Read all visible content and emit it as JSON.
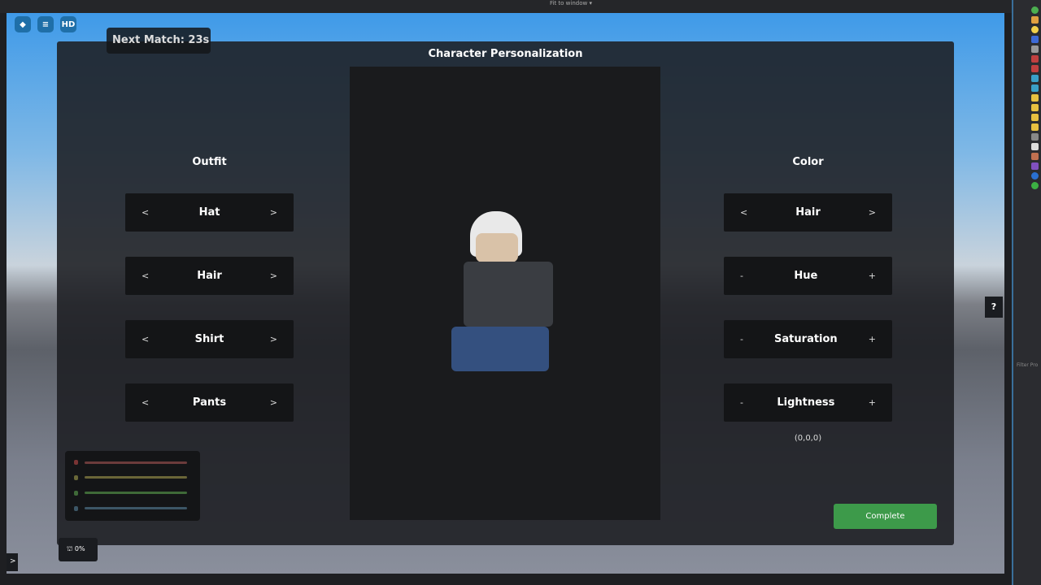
{
  "studio": {
    "view_mode": "Fit to window ▾",
    "filter_placeholder": "Filter Pro"
  },
  "toolbar": {
    "hd_label": "HD"
  },
  "hud": {
    "next_match": "Next Match: 23s",
    "download_percent": "0%",
    "expand": ">",
    "help": "?"
  },
  "panel": {
    "title": "Character Personalization",
    "outfit": {
      "title": "Outfit",
      "items": [
        {
          "label": "Hat",
          "prev": "<",
          "next": ">"
        },
        {
          "label": "Hair",
          "prev": "<",
          "next": ">"
        },
        {
          "label": "Shirt",
          "prev": "<",
          "next": ">"
        },
        {
          "label": "Pants",
          "prev": "<",
          "next": ">"
        }
      ]
    },
    "color": {
      "title": "Color",
      "items": [
        {
          "label": "Hair",
          "prev": "<",
          "next": ">"
        },
        {
          "label": "Hue",
          "prev": "-",
          "next": "+"
        },
        {
          "label": "Saturation",
          "prev": "-",
          "next": "+"
        },
        {
          "label": "Lightness",
          "prev": "-",
          "next": "+"
        }
      ],
      "value": "(0,0,0)"
    },
    "complete_label": "Complete"
  },
  "colors": {
    "accent": "#3d9a4a",
    "panel": "#1c1e22"
  }
}
